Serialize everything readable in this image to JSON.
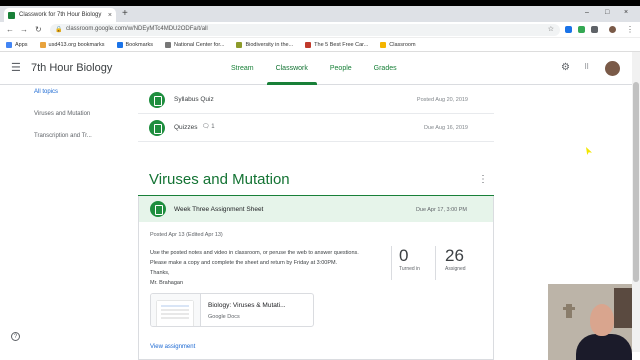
{
  "browser": {
    "tab_title": "Classwork for 7th Hour Biology",
    "tab_close": "×",
    "new_tab": "+",
    "url": "classroom.google.com/w/NDEyMTc4MDU2ODFa/t/all",
    "window_controls": [
      "–",
      "□",
      "×"
    ],
    "back": "←",
    "forward": "→",
    "reload": "↻",
    "bookmark_star": "☆"
  },
  "bookmarks": [
    {
      "label": "Apps",
      "color": "#4285f4"
    },
    {
      "label": "usd413.org bookmarks",
      "color": "#e8a33d"
    },
    {
      "label": "Bookmarks",
      "color": "#1a73e8"
    },
    {
      "label": "National Center for...",
      "color": "#777777"
    },
    {
      "label": "Biodiversity in the...",
      "color": "#8d9b2a"
    },
    {
      "label": "The 5 Best Free Car...",
      "color": "#c0392b"
    },
    {
      "label": "Classroom",
      "color": "#f4b400"
    }
  ],
  "header": {
    "class_name": "7th Hour Biology",
    "tabs": [
      "Stream",
      "Classwork",
      "People",
      "Grades"
    ],
    "active_tab": "Classwork",
    "settings_icon": "⚙",
    "apps_icon": "⋮⋮⋮"
  },
  "topics": {
    "items": [
      "All topics",
      "Viruses and Mutation",
      "Transcription and Tr..."
    ],
    "active": "All topics"
  },
  "items": [
    {
      "title": "Syllabus Quiz",
      "date": "Posted Aug 20, 2019",
      "comments": ""
    },
    {
      "title": "Quizzes",
      "date": "Due Aug 16, 2019",
      "comments": "1"
    }
  ],
  "section": {
    "title": "Viruses and Mutation",
    "menu_icon": "⋮"
  },
  "assignment": {
    "title": "Week Three Assignment Sheet",
    "due": "Due Apr 17, 3:00 PM",
    "posted": "Posted Apr 13 (Edited Apr 13)",
    "instructions": [
      "Use the posted notes and video in classroom, or peruse the web to answer questions.",
      "Please make a copy and complete the sheet and return by Friday at 3:00PM.",
      "Thanks,",
      "Mr. Brahagan"
    ],
    "turned_in": "0",
    "turned_in_label": "Turned in",
    "assigned": "26",
    "assigned_label": "Assigned",
    "attachment_name": "Biology: Viruses & Mutati...",
    "attachment_type": "Google Docs",
    "view_link": "View assignment"
  },
  "help_icon": "?"
}
